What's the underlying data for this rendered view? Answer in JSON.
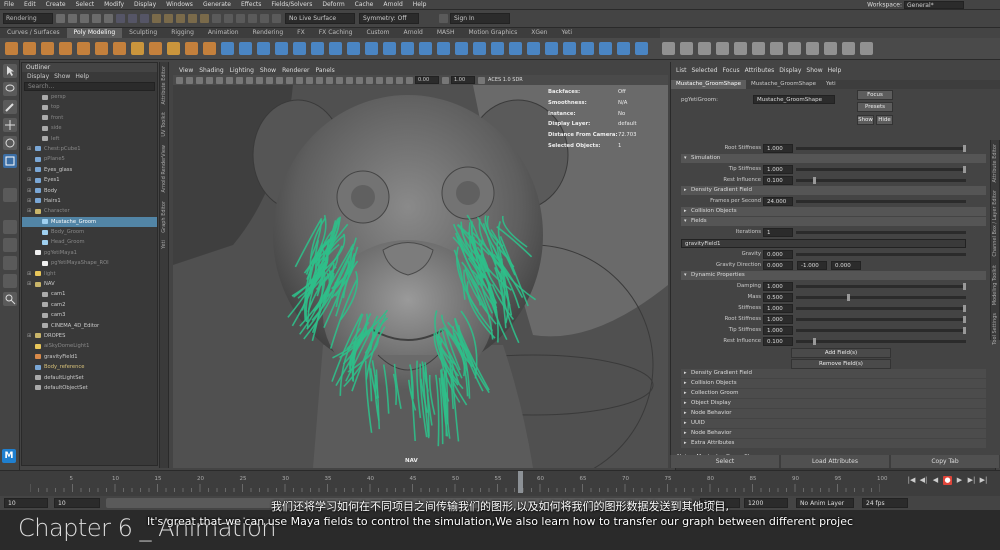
{
  "menubar": {
    "items": [
      "File",
      "Edit",
      "Create",
      "Select",
      "Modify",
      "Display",
      "Windows",
      "Generate",
      "Effects",
      "Fields/Solvers",
      "Deform",
      "Cache",
      "Arnold",
      "Help"
    ],
    "workspace_label": "Workspace:",
    "workspace_value": "General*"
  },
  "statusline": {
    "mode": "Rendering",
    "live_surface": "No Live Surface",
    "symmetry": "Symmetry: Off",
    "sign_in": "Sign In"
  },
  "shelf": {
    "tabs": [
      "Curves / Surfaces",
      "Poly Modeling",
      "Sculpting",
      "Rigging",
      "Animation",
      "Rendering",
      "FX",
      "FX Caching",
      "Custom",
      "Arnold",
      "MASH",
      "Motion Graphics",
      "XGen",
      "Yeti"
    ],
    "active_tab": 1
  },
  "outliner": {
    "title": "Outliner",
    "menu": [
      "Display",
      "Show",
      "Help"
    ],
    "search_placeholder": "Search...",
    "items": [
      {
        "label": "persp",
        "dim": true,
        "icon": "camera-icon"
      },
      {
        "label": "top",
        "dim": true,
        "icon": "camera-icon"
      },
      {
        "label": "front",
        "dim": true,
        "icon": "camera-icon"
      },
      {
        "label": "side",
        "dim": true,
        "icon": "camera-icon"
      },
      {
        "label": "left",
        "dim": true,
        "icon": "camera-icon"
      },
      {
        "label": "Chest:pCube1",
        "dim": true,
        "icon": "mesh-icon"
      },
      {
        "label": "pPlane5",
        "dim": true,
        "icon": "mesh-icon"
      },
      {
        "label": "Eyes_glass",
        "dim": false,
        "icon": "mesh-icon"
      },
      {
        "label": "Eyes1",
        "dim": false,
        "icon": "mesh-icon"
      },
      {
        "label": "Body",
        "dim": false,
        "icon": "mesh-icon"
      },
      {
        "label": "Hairs1",
        "dim": false,
        "icon": "mesh-icon"
      },
      {
        "label": "Character",
        "dim": true,
        "icon": "group-icon"
      },
      {
        "label": "Mustache_Groom",
        "dim": false,
        "icon": "groom-icon",
        "selected": true
      },
      {
        "label": "Body_Groom",
        "dim": true,
        "icon": "groom-icon"
      },
      {
        "label": "Head_Groom",
        "dim": true,
        "icon": "groom-icon"
      },
      {
        "label": "pgYetiMaya1",
        "dim": true,
        "icon": "yeti-icon"
      },
      {
        "label": "pgYetiMayaShape_ROI",
        "dim": true,
        "icon": "yeti-icon"
      },
      {
        "label": "light",
        "dim": true,
        "icon": "light-icon"
      },
      {
        "label": "NAV",
        "dim": false,
        "icon": "group-icon"
      },
      {
        "label": "cam1",
        "dim": false,
        "icon": "camera-icon"
      },
      {
        "label": "cam2",
        "dim": false,
        "icon": "camera-icon"
      },
      {
        "label": "cam3",
        "dim": false,
        "icon": "camera-icon"
      },
      {
        "label": "CINEMA_4D_Editor",
        "dim": false,
        "icon": "camera-icon"
      },
      {
        "label": "DROPES",
        "dim": false,
        "icon": "group-icon"
      },
      {
        "label": "aiSkyDomeLight1",
        "dim": true,
        "icon": "light-icon"
      },
      {
        "label": "gravityField1",
        "dim": false,
        "icon": "field-icon"
      },
      {
        "label": "Body_reference",
        "dim": false,
        "icon": "mesh-icon",
        "yellow": true
      },
      {
        "label": "defaultLightSet",
        "dim": false,
        "icon": "set-icon"
      },
      {
        "label": "defaultObjectSet",
        "dim": false,
        "icon": "set-icon"
      }
    ]
  },
  "side_tabs_left": [
    "Attribute Editor",
    "UV Toolkit",
    "Arnold RenderView",
    "Graph Editor",
    "Yeti"
  ],
  "viewport": {
    "menu": [
      "View",
      "Shading",
      "Lighting",
      "Show",
      "Renderer",
      "Panels"
    ],
    "field_a": "0.00",
    "field_b": "1.00",
    "color_space": "ACES 1.0 SDR",
    "camera_label": "NAV",
    "hud": [
      {
        "k": "Backfaces:",
        "v": "Off"
      },
      {
        "k": "Smoothness:",
        "v": "N/A"
      },
      {
        "k": "Instance:",
        "v": "No"
      },
      {
        "k": "Display Layer:",
        "v": "default"
      },
      {
        "k": "Distance From Camera:",
        "v": "72.703"
      },
      {
        "k": "Selected Objects:",
        "v": "1"
      }
    ]
  },
  "attribute_editor": {
    "menu": [
      "List",
      "Selected",
      "Focus",
      "Attributes",
      "Display",
      "Show",
      "Help"
    ],
    "tabs": [
      "Mustache_GroomShape",
      "Mustache_GroomShape",
      "Yeti"
    ],
    "groom_label": "pgYetiGroom:",
    "groom_value": "Mustache_GroomShape",
    "focus": "Focus",
    "presets": "Presets",
    "show": "Show",
    "hide": "Hide",
    "rows": [
      {
        "type": "attr",
        "label": "Root Stiffness",
        "value": "1.000",
        "knob": 0.98
      },
      {
        "type": "section",
        "label": "Simulation",
        "open": true
      },
      {
        "type": "attr",
        "label": "Tip Stiffness",
        "value": "1.000",
        "knob": 0.98
      },
      {
        "type": "attr",
        "label": "Rest Influence",
        "value": "0.100",
        "knob": 0.1
      },
      {
        "type": "section",
        "label": "Density Gradient Field",
        "open": false
      },
      {
        "type": "attr",
        "label": "Frames per Second",
        "value": "24.000",
        "knob": null
      },
      {
        "type": "section",
        "label": "Collision Objects",
        "open": false
      },
      {
        "type": "section",
        "label": "Fields",
        "open": true
      },
      {
        "type": "attr",
        "label": "Iterations",
        "value": "1",
        "knob": null
      },
      {
        "type": "field",
        "label": "gravityField1",
        "value": ""
      },
      {
        "type": "attr",
        "label": "Gravity",
        "value": "0.000",
        "knob": null
      },
      {
        "type": "vec",
        "label": "Gravity Direction",
        "values": [
          "0.000",
          "-1.000",
          "0.000"
        ]
      },
      {
        "type": "section",
        "label": "Dynamic Properties",
        "open": true
      },
      {
        "type": "attr",
        "label": "Damping",
        "value": "1.000",
        "knob": 0.98
      },
      {
        "type": "attr",
        "label": "Mass",
        "value": "0.500",
        "knob": 0.3
      },
      {
        "type": "attr",
        "label": "Stiffness",
        "value": "1.000",
        "knob": 0.98
      },
      {
        "type": "attr",
        "label": "Root Stiffness",
        "value": "1.000",
        "knob": 0.98
      },
      {
        "type": "attr",
        "label": "Tip Stiffness",
        "value": "1.000",
        "knob": 0.98
      },
      {
        "type": "attr",
        "label": "Rest Influence",
        "value": "0.100",
        "knob": 0.1
      }
    ],
    "add_field": "Add Field(s)",
    "remove_field": "Remove Field(s)",
    "collapsed_sections": [
      "Density Gradient Field",
      "Collision Objects",
      "Collection Groom",
      "Object Display",
      "Node Behavior",
      "UUID",
      "Node Behavior",
      "Extra Attributes"
    ],
    "notes_label": "Notes:  Mustache_GroomShape",
    "bottom_buttons": [
      "Select",
      "Load Attributes",
      "Copy Tab"
    ]
  },
  "side_tabs_right": [
    "Attribute Editor",
    "Channel Box / Layer Editor",
    "Modeling Toolkit",
    "Tool Settings"
  ],
  "timeslider": {
    "ticks": [
      "5",
      "10",
      "15",
      "20",
      "25",
      "30",
      "35",
      "40",
      "45",
      "50",
      "55",
      "60",
      "65",
      "70",
      "75",
      "80",
      "85",
      "90",
      "95",
      "100"
    ],
    "current_frame": "64"
  },
  "range": {
    "start": "10",
    "start_inner": "10",
    "end_inner": "1200",
    "end": "1200",
    "anim_layer": "No Anim Layer",
    "fps": "24 fps"
  },
  "overlay": {
    "chapter": "Chapter 6 _ Animation",
    "sub_cn": "我们还将学习如何在不同项目之间传输我们的图形,以及如何将我们的图形数据发送到其他项目,",
    "sub_en": "It's great that we can use Maya fields to control the simulation,We also learn how to transfer our graph between different projec"
  },
  "colors": {
    "selection": "#5285a6",
    "groom": "#2fbf8a",
    "maya_blue": "#1f7fcf",
    "record": "#e0453a"
  }
}
